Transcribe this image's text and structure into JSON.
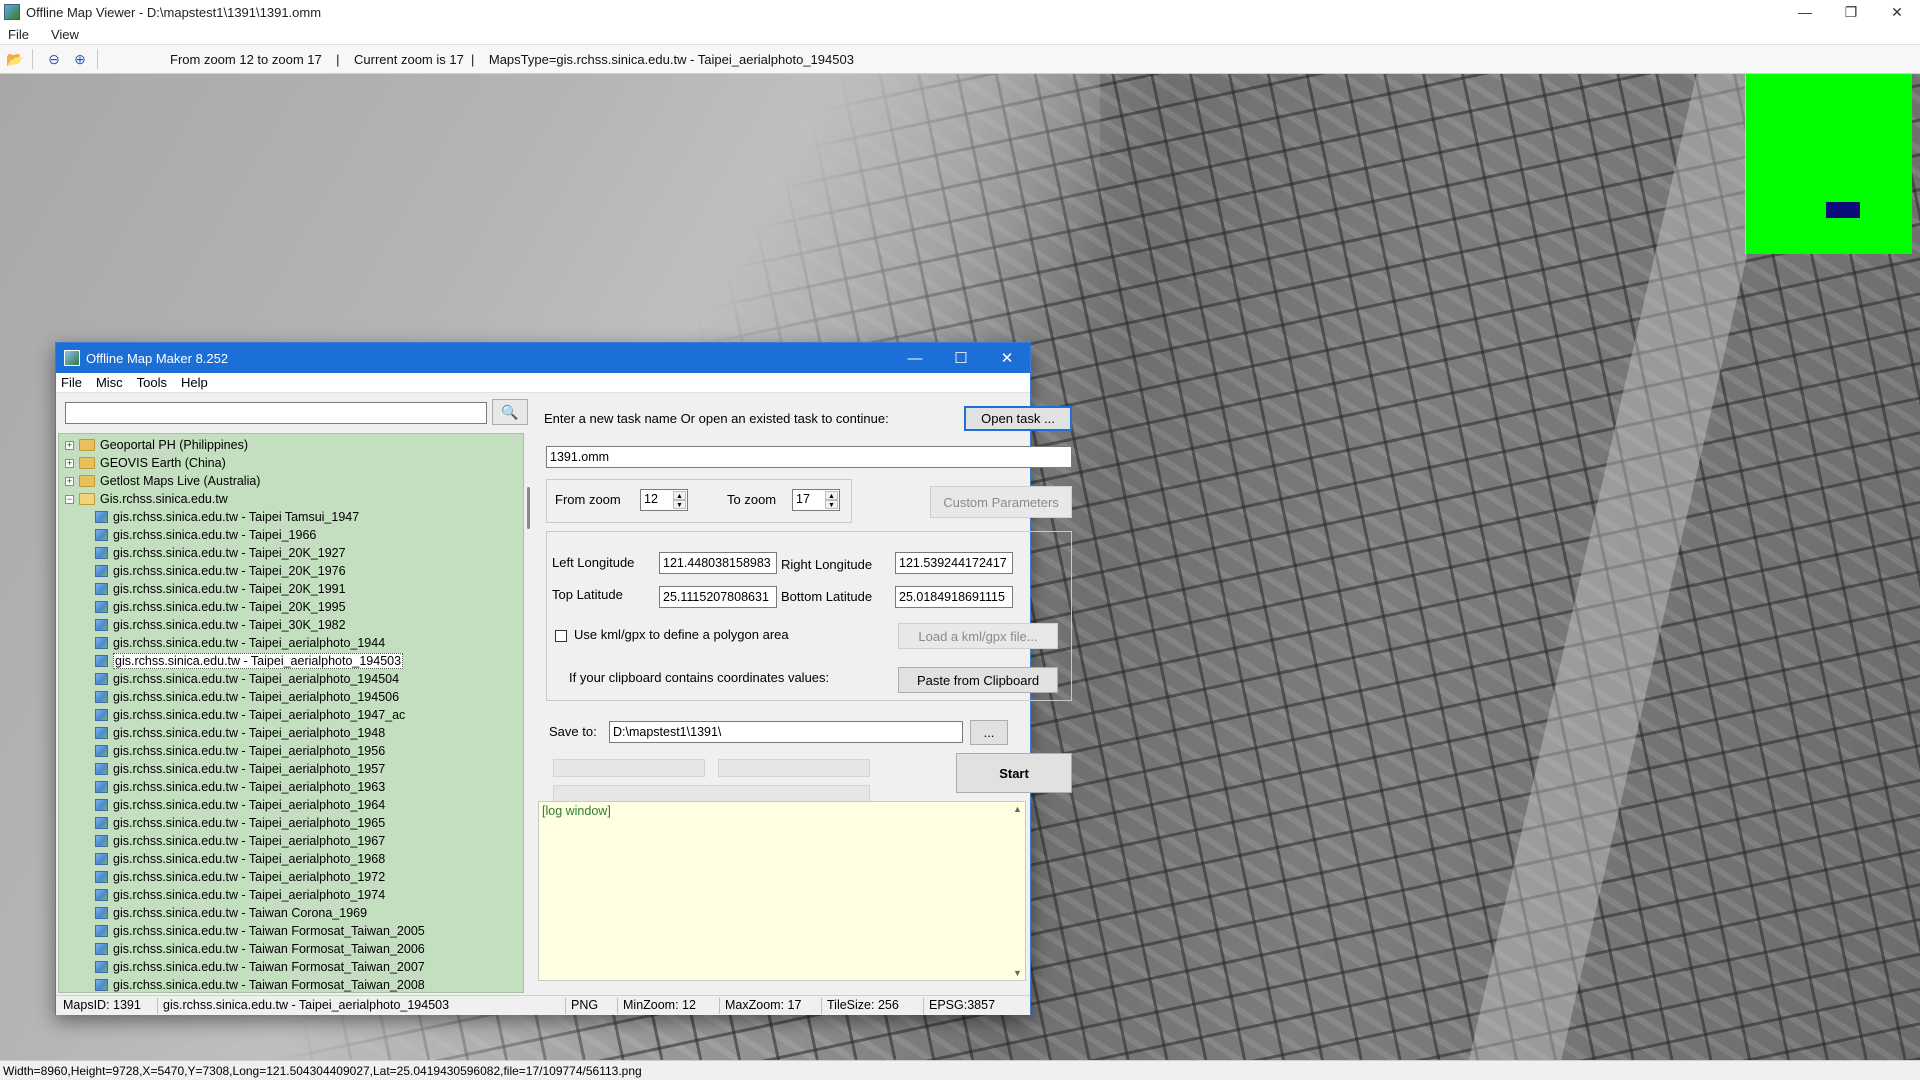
{
  "viewer": {
    "title": "Offline Map Viewer - D:\\mapstest1\\1391\\1391.omm",
    "menu": [
      "File",
      "View"
    ],
    "window_controls": {
      "minimize": "—",
      "maximize": "❐",
      "close": "✕"
    },
    "toolbar": {
      "open_icon": "folder-open-icon",
      "zoom_out_icon": "zoom-out-icon",
      "zoom_in_icon": "zoom-in-icon",
      "info": "From zoom 12 to zoom 17    |    Current zoom is 17  |    MapsType=gis.rchss.sinica.edu.tw - Taipei_aerialphoto_194503"
    },
    "minimap": {
      "background": "#00ff00",
      "viewport_color": "#0b0b7a"
    },
    "status": "Width=8960,Height=9728,X=5470,Y=7308,Long=121.504304409027,Lat=25.0419430596082,file=17/109774/56113.png"
  },
  "dialog": {
    "title": "Offline Map Maker 8.252",
    "window_controls": {
      "minimize": "—",
      "maximize": "☐",
      "close": "✕"
    },
    "menu": [
      "File",
      "Misc",
      "Tools",
      "Help"
    ],
    "search": {
      "value": "",
      "placeholder": "",
      "icon": "search-icon"
    },
    "tree": {
      "folders": [
        {
          "label": "Geoportal PH (Philippines)",
          "expander": "+"
        },
        {
          "label": "GEOVIS Earth (China)",
          "expander": "+"
        },
        {
          "label": "Getlost Maps Live (Australia)",
          "expander": "+"
        },
        {
          "label": "Gis.rchss.sinica.edu.tw",
          "expander": "−"
        }
      ],
      "items": [
        "gis.rchss.sinica.edu.tw - Taipei Tamsui_1947",
        "gis.rchss.sinica.edu.tw - Taipei_1966",
        "gis.rchss.sinica.edu.tw - Taipei_20K_1927",
        "gis.rchss.sinica.edu.tw - Taipei_20K_1976",
        "gis.rchss.sinica.edu.tw - Taipei_20K_1991",
        "gis.rchss.sinica.edu.tw - Taipei_20K_1995",
        "gis.rchss.sinica.edu.tw - Taipei_30K_1982",
        "gis.rchss.sinica.edu.tw - Taipei_aerialphoto_1944",
        "gis.rchss.sinica.edu.tw - Taipei_aerialphoto_194503",
        "gis.rchss.sinica.edu.tw - Taipei_aerialphoto_194504",
        "gis.rchss.sinica.edu.tw - Taipei_aerialphoto_194506",
        "gis.rchss.sinica.edu.tw - Taipei_aerialphoto_1947_ac",
        "gis.rchss.sinica.edu.tw - Taipei_aerialphoto_1948",
        "gis.rchss.sinica.edu.tw - Taipei_aerialphoto_1956",
        "gis.rchss.sinica.edu.tw - Taipei_aerialphoto_1957",
        "gis.rchss.sinica.edu.tw - Taipei_aerialphoto_1963",
        "gis.rchss.sinica.edu.tw - Taipei_aerialphoto_1964",
        "gis.rchss.sinica.edu.tw - Taipei_aerialphoto_1965",
        "gis.rchss.sinica.edu.tw - Taipei_aerialphoto_1967",
        "gis.rchss.sinica.edu.tw - Taipei_aerialphoto_1968",
        "gis.rchss.sinica.edu.tw - Taipei_aerialphoto_1972",
        "gis.rchss.sinica.edu.tw - Taipei_aerialphoto_1974",
        "gis.rchss.sinica.edu.tw - Taiwan Corona_1969",
        "gis.rchss.sinica.edu.tw - Taiwan Formosat_Taiwan_2005",
        "gis.rchss.sinica.edu.tw - Taiwan Formosat_Taiwan_2006",
        "gis.rchss.sinica.edu.tw - Taiwan Formosat_Taiwan_2007",
        "gis.rchss.sinica.edu.tw - Taiwan Formosat_Taiwan_2008"
      ],
      "selected_item": "gis.rchss.sinica.edu.tw - Taipei_aerialphoto_194503",
      "background": "#c4dfc0"
    },
    "task": {
      "prompt": "Enter a new task name Or open an existed task to continue:",
      "open_button": "Open task ...",
      "name_value": "1391.omm"
    },
    "zoom": {
      "from_label": "From zoom",
      "from_value": "12",
      "to_label": "To zoom",
      "to_value": "17",
      "custom_button": "Custom Parameters"
    },
    "coords": {
      "left_lon_label": "Left Longitude",
      "left_lon_value": "121.448038158983",
      "right_lon_label": "Right Longitude",
      "right_lon_value": "121.539244172417",
      "top_lat_label": "Top Latitude",
      "top_lat_value": "25.1115207808631",
      "bottom_lat_label": "Bottom Latitude",
      "bottom_lat_value": "25.0184918691115",
      "kml_checkbox_label": "Use kml/gpx to define a polygon area",
      "kml_checked": false,
      "load_kml_button": "Load a kml/gpx file...",
      "clipboard_label": "If your clipboard contains coordinates values:",
      "paste_button": "Paste from Clipboard"
    },
    "save": {
      "label": "Save to:",
      "path": "D:\\mapstest1\\1391\\",
      "browse_button": "...",
      "start_button": "Start"
    },
    "progress": {
      "bar1": 0,
      "bar2": 0,
      "bar3": 0
    },
    "log": {
      "text": "[log window]",
      "up_arrow": "▲",
      "down_arrow": "▼",
      "background": "#ffffe1"
    },
    "status": {
      "maps_id": "MapsID: 1391",
      "map_name": "gis.rchss.sinica.edu.tw - Taipei_aerialphoto_194503",
      "format": "PNG",
      "min_zoom": "MinZoom: 12",
      "max_zoom": "MaxZoom: 17",
      "tile_size": "TileSize: 256",
      "epsg": "EPSG:3857"
    },
    "accent_color": "#1c6fd6"
  }
}
